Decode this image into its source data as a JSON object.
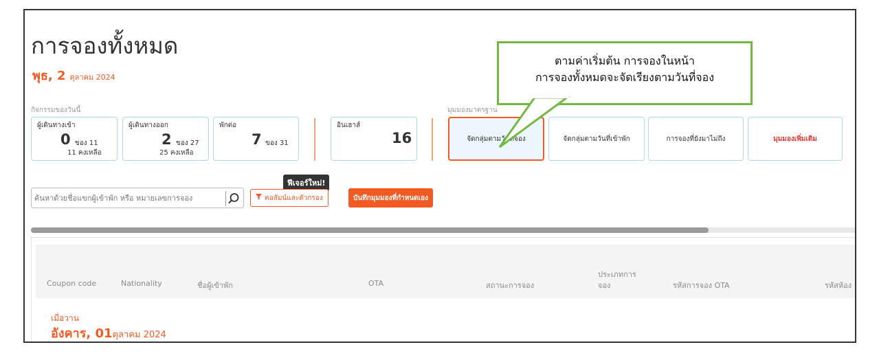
{
  "header": {
    "title": "การจองทั้งหมด",
    "date_day": "พุธ, 2",
    "date_month": "ตุลาคม 2024"
  },
  "activities": {
    "section_label": "กิจกรรมของวันนี้",
    "arrivals": {
      "label": "ผู้เดินทางเข้า",
      "count": "0",
      "of": "ของ 11",
      "remaining": "11 คงเหลือ"
    },
    "departures": {
      "label": "ผู้เดินทางออก",
      "count": "2",
      "of": "ของ 27",
      "remaining": "25 คงเหลือ"
    },
    "stayovers": {
      "label": "พักต่อ",
      "count": "7",
      "of": "ของ 31"
    },
    "inhouse": {
      "label": "อินเฮาส์",
      "count": "16"
    }
  },
  "views": {
    "section_label": "มุมมองมาตรฐาน",
    "items": [
      {
        "label": "จัดกลุ่มตามวันที่จอง",
        "active": true
      },
      {
        "label": "จัดกลุ่มตามวันที่เข้าพัก",
        "active": false
      },
      {
        "label": "การจองที่ยังมาไม่ถึง",
        "active": false
      },
      {
        "label": "มุมมองเพิ่มเติม",
        "active": false
      }
    ]
  },
  "callout": {
    "line1": "ตามค่าเริ่มต้น การจองในหน้า",
    "line2": "การจองทั้งหมดจะจัดเรียงตามวันที่จอง"
  },
  "toolbar": {
    "new_feature_badge": "ฟีเจอร์ใหม่!",
    "search_placeholder": "ค้นหาด้วยชื่อแขกผู้เข้าพัก หรือ หมายเลขการจอง",
    "filter_label": "คอลัมน์และตัวกรอง",
    "save_view_label": "บันทึกมุมมองที่กำหนดเอง"
  },
  "table": {
    "columns": {
      "coupon": "Coupon code",
      "nationality": "Nationality",
      "guest_name": "ชื่อผู้เข้าพัก",
      "ota": "OTA",
      "status": "สถานะการจอง",
      "type_line1": "ประเภทการ",
      "type_line2": "จอง",
      "ota_code": "รหัสการจอง OTA",
      "room_code": "รหัสห้อง"
    },
    "group": {
      "label": "เมื่อวาน",
      "day": "อังคาร, 01",
      "month": "ตุลาคม 2024"
    }
  },
  "colors": {
    "accent": "#f15a22",
    "card_border": "#a9d8f2",
    "callout_border": "#72b841"
  }
}
